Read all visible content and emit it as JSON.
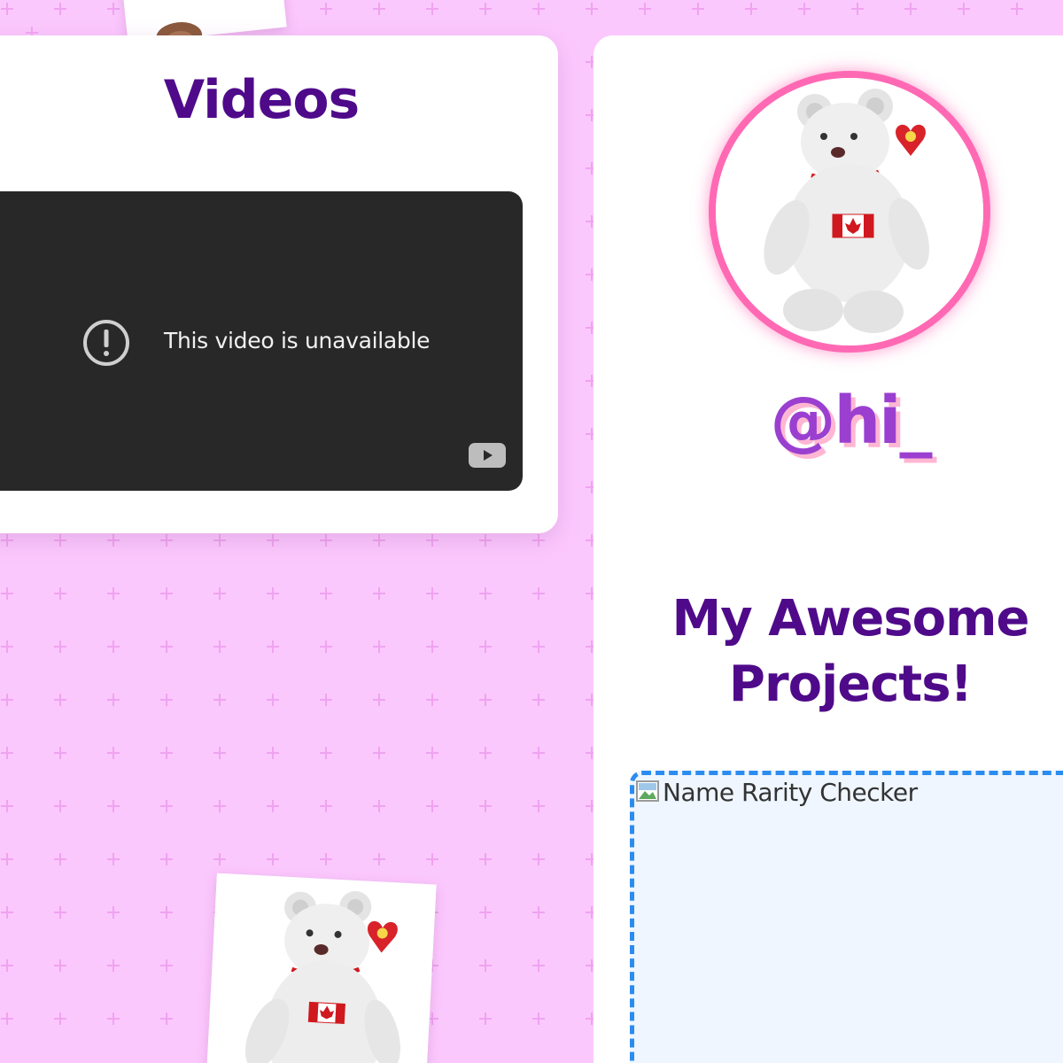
{
  "videos_section": {
    "title": "Videos",
    "player": {
      "message": "This video is unavailable"
    }
  },
  "profile": {
    "username": "@hi_",
    "avatar_icon": "white-teddy-bear-with-canada-flag-icon"
  },
  "projects_section": {
    "title": "My Awesome Projects!",
    "projects": [
      {
        "alt_text": "Name Rarity Checker"
      }
    ]
  },
  "decorations": {
    "photo_icons": [
      "teddy-bear-photo-icon",
      "teddy-bear-photo-icon"
    ]
  },
  "colors": {
    "background": "#fbc8fd",
    "background_pattern": "#f3a7f3",
    "heading": "#4f0a8a",
    "username": "#9a3fd0",
    "username_shadow": "#ffb6d2",
    "avatar_ring": "#ff69b4",
    "video_background": "#282828",
    "project_border": "#2b8cf0",
    "project_background": "#eff6ff"
  }
}
